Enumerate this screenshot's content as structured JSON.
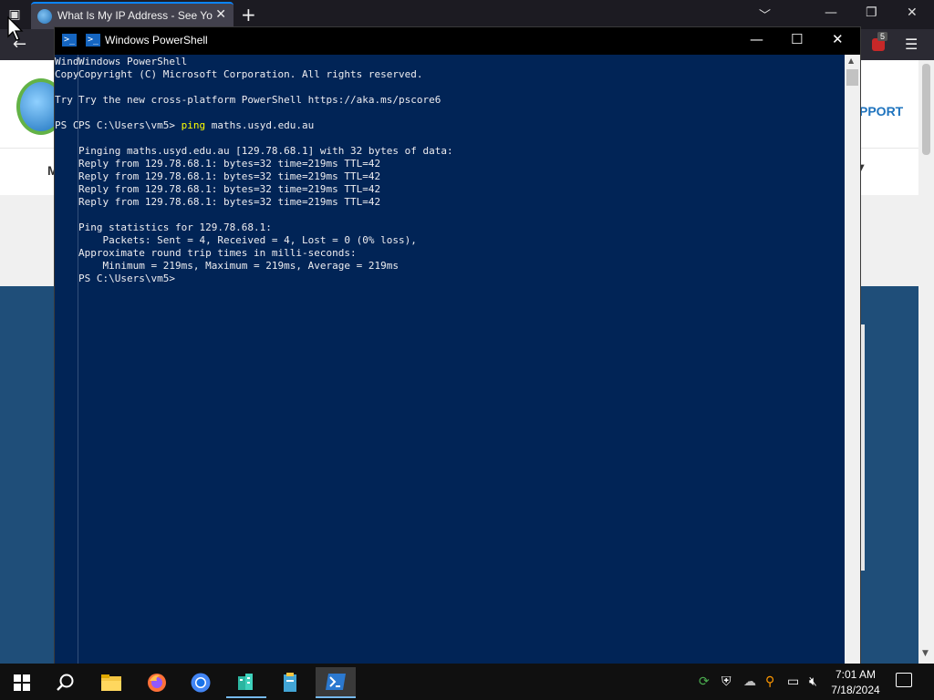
{
  "browser": {
    "tab_title": "What Is My IP Address - See Your",
    "new_tab_symbol": "+",
    "tab_close_symbol": "✕",
    "extension_badge": "5",
    "page_support_text": "PPORT",
    "page_nav_letter": "M"
  },
  "powershell": {
    "window_title": "Windows PowerShell",
    "console_lines": [
      {
        "prefix": "Wind",
        "text": "Windows PowerShell"
      },
      {
        "prefix": "Copy",
        "text": "Copyright (C) Microsoft Corporation. All rights reserved."
      },
      {
        "prefix": "",
        "text": ""
      },
      {
        "prefix": "Try ",
        "text": "Try the new cross-platform PowerShell https://aka.ms/pscore6"
      },
      {
        "prefix": "",
        "text": ""
      },
      {
        "prefix": "PS C",
        "text": "PS C:\\Users\\vm5> ",
        "command": "ping",
        "args": " maths.usyd.edu.au"
      },
      {
        "prefix": "",
        "text": ""
      },
      {
        "prefix": "",
        "text": "Pinging maths.usyd.edu.au [129.78.68.1] with 32 bytes of data:"
      },
      {
        "prefix": "",
        "text": "Reply from 129.78.68.1: bytes=32 time=219ms TTL=42"
      },
      {
        "prefix": "",
        "text": "Reply from 129.78.68.1: bytes=32 time=219ms TTL=42"
      },
      {
        "prefix": "",
        "text": "Reply from 129.78.68.1: bytes=32 time=219ms TTL=42"
      },
      {
        "prefix": "",
        "text": "Reply from 129.78.68.1: bytes=32 time=219ms TTL=42"
      },
      {
        "prefix": "",
        "text": ""
      },
      {
        "prefix": "",
        "text": "Ping statistics for 129.78.68.1:"
      },
      {
        "prefix": "",
        "text": "    Packets: Sent = 4, Received = 4, Lost = 0 (0% loss),"
      },
      {
        "prefix": "",
        "text": "Approximate round trip times in milli-seconds:"
      },
      {
        "prefix": "",
        "text": "    Minimum = 219ms, Maximum = 219ms, Average = 219ms"
      },
      {
        "prefix": "",
        "text": "PS C:\\Users\\vm5>"
      }
    ],
    "colors": {
      "background": "#012456",
      "text": "#eeedf0",
      "command": "#fefe00"
    }
  },
  "taskbar": {
    "clock_time": "7:01 AM",
    "clock_date": "7/18/2024",
    "pinned": [
      "start-icon",
      "search-icon",
      "file-explorer-icon",
      "firefox-icon",
      "chrome-icon",
      "app-icon-1",
      "app-icon-2",
      "powershell-icon"
    ],
    "tray": [
      "network-app-icon",
      "security-icon",
      "cloud-icon",
      "search-tray-icon",
      "network-icon",
      "volume-muted-icon"
    ]
  }
}
